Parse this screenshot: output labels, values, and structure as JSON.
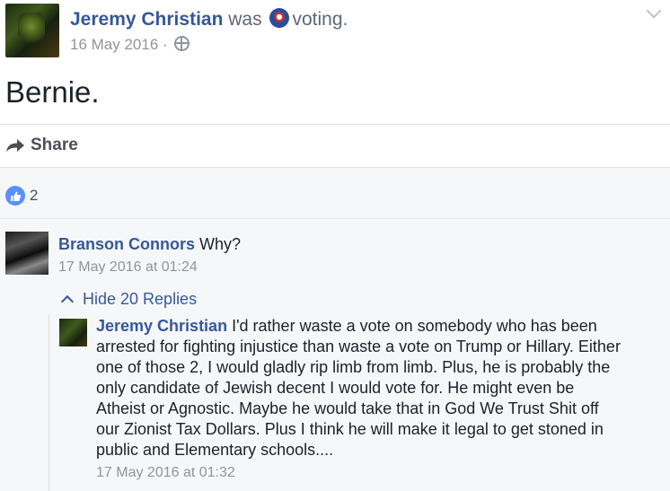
{
  "post": {
    "author": "Jeremy Christian",
    "was": "was",
    "activity_icon": "voting-badge-icon",
    "activity": "voting.",
    "date": "16 May 2016",
    "separator": "·",
    "privacy_icon": "globe-icon",
    "text": "Bernie.",
    "share_label": "Share"
  },
  "reactions": {
    "icon": "thumbs-up-icon",
    "count": "2"
  },
  "comment": {
    "author": "Branson Connors",
    "text": "Why?",
    "time": "17 May 2016 at 01:24",
    "toggle_label": "Hide 20 Replies"
  },
  "reply": {
    "author": "Jeremy Christian",
    "text": "I'd rather waste a vote on somebody who has been arrested for fighting injustice than waste a vote on Trump or Hillary. Either one of those 2, I would gladly rip limb from limb. Plus, he is probably the only candidate of Jewish decent I would vote for. He might even be Atheist or Agnostic. Maybe he would take that in God We Trust Shit off our Zionist Tax Dollars. Plus I think he will make it legal to get stoned in public and Elementary schools....",
    "time": "17 May 2016 at 01:32"
  },
  "colors": {
    "link": "#365899",
    "meta": "#90949c",
    "like_badge": "#5890ff",
    "comments_bg": "#f6f7f9"
  }
}
